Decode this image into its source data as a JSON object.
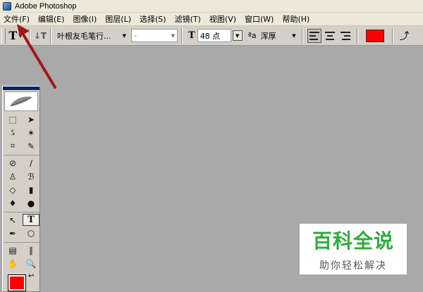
{
  "window": {
    "title": "Adobe Photoshop"
  },
  "menubar": {
    "items": [
      {
        "label": "文件(F)"
      },
      {
        "label": "编辑(E)"
      },
      {
        "label": "图像(I)"
      },
      {
        "label": "图层(L)"
      },
      {
        "label": "选择(S)"
      },
      {
        "label": "滤镜(T)"
      },
      {
        "label": "视图(V)"
      },
      {
        "label": "窗口(W)"
      },
      {
        "label": "帮助(H)"
      }
    ]
  },
  "options": {
    "tool_glyph": "T",
    "font_family": "叶根友毛笔行...",
    "font_style": "-",
    "font_size": "48 点",
    "antialias": "浑厚",
    "text_color": "#ff0000"
  },
  "toolbox": {
    "fg_color": "#ff0000",
    "text_tool_glyph": "T"
  },
  "watermark": {
    "title": "百科全说",
    "subtitle": "助你轻松解决",
    "color": "#2dac3a"
  },
  "annotation": {
    "color": "#a01818"
  }
}
